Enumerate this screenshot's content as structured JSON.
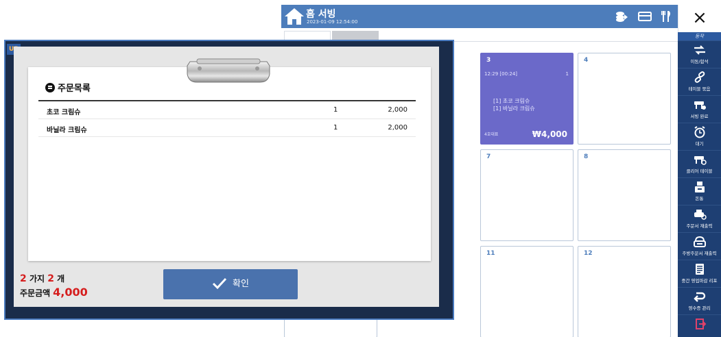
{
  "pos": {
    "title": "홈 서빙",
    "datetime": "2023-01-09 12:54:00",
    "tabs": [
      "",
      ""
    ],
    "tables": [
      {
        "number": "",
        "occupied": false
      },
      {
        "number": "3",
        "occupied": true,
        "time": "12:29 [00:24]",
        "guests": "1",
        "items": [
          "[1] 초코 크림슈",
          "[1] 바닐라 크림슈"
        ],
        "foot": "4호대표",
        "total": "₩4,000"
      },
      {
        "number": "4",
        "occupied": false
      },
      {
        "number": "",
        "occupied": false
      },
      {
        "number": "7",
        "occupied": false
      },
      {
        "number": "8",
        "occupied": false
      },
      {
        "number": "",
        "occupied": false
      },
      {
        "number": "11",
        "occupied": false
      },
      {
        "number": "12",
        "occupied": false
      }
    ]
  },
  "sidebar": {
    "close": "×",
    "section": "동작",
    "items": [
      {
        "label": "이동/합석",
        "icon": "move-icon"
      },
      {
        "label": "테이블 묶음",
        "icon": "link-icon"
      },
      {
        "label": "서빙 완료",
        "icon": "serve-icon"
      },
      {
        "label": "대기",
        "icon": "clock-icon"
      },
      {
        "label": "클리어 테이블",
        "icon": "clear-table-icon"
      },
      {
        "label": "돈통",
        "icon": "cash-drawer-icon"
      },
      {
        "label": "주문서 재출력",
        "icon": "printer-icon"
      },
      {
        "label": "주방주문서 재출력",
        "icon": "kitchen-printer-icon"
      },
      {
        "label": "중간 영업마감 리포",
        "icon": "report-icon"
      },
      {
        "label": "영수증 관리",
        "icon": "return-icon"
      },
      {
        "label": "",
        "icon": "logout-icon"
      }
    ]
  },
  "dialog": {
    "corner_hint": "UP",
    "heading": "주문목록",
    "orders": [
      {
        "name": "초코 크림슈",
        "qty": "1",
        "price": "2,000"
      },
      {
        "name": "바닐라 크림슈",
        "qty": "1",
        "price": "2,000"
      }
    ],
    "summary": {
      "kinds": "2",
      "kinds_label": "가지",
      "count": "2",
      "count_label": "개",
      "amount_label": "주문금액",
      "amount": "4,000"
    },
    "confirm": "확인"
  },
  "colors": {
    "header_blue": "#4d7dbb",
    "sidebar_navy": "#1e3f73",
    "occupied_purple": "#6b69c9",
    "confirm_blue": "#4a72ad",
    "accent_red": "#d51d1d"
  }
}
